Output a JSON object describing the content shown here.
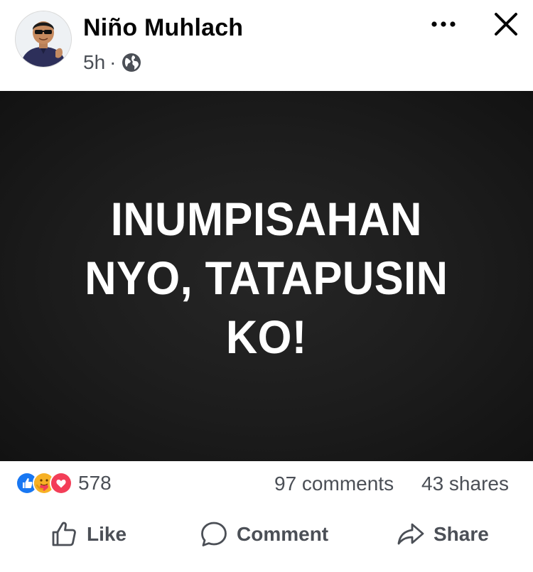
{
  "post": {
    "author": "Niño Muhlach",
    "time": "5h",
    "separator": "·",
    "audience_icon": "globe-icon",
    "more_icon": "ellipsis-icon",
    "close_icon": "close-icon",
    "image_text_lines": [
      "INUMPISAHAN",
      "NYO, TATAPUSIN",
      "KO!"
    ]
  },
  "stats": {
    "reaction_icons": [
      "like-reaction-icon",
      "care-reaction-icon",
      "love-reaction-icon"
    ],
    "reaction_count": "578",
    "comments": "97 comments",
    "shares": "43 shares"
  },
  "actions": {
    "like": "Like",
    "comment": "Comment",
    "share": "Share"
  },
  "colors": {
    "like_blue": "#1877f2",
    "love_red": "#f33e58",
    "care_yellow": "#f7b125",
    "text_secondary": "#4b4f56",
    "image_bg": "#1c1c1c"
  }
}
